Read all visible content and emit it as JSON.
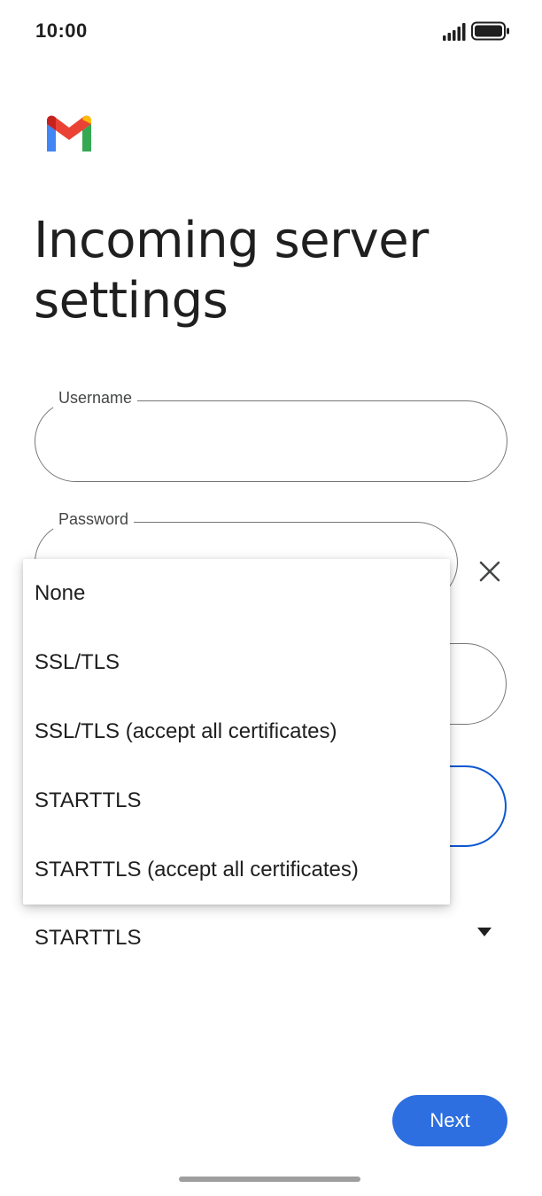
{
  "status_bar": {
    "time": "10:00"
  },
  "page": {
    "title": "Incoming server settings"
  },
  "form": {
    "username": {
      "label": "Username",
      "value": ""
    },
    "password": {
      "label": "Password",
      "value": ""
    },
    "security_type": {
      "selected": "STARTTLS"
    }
  },
  "dropdown": {
    "options": [
      "None",
      "SSL/TLS",
      "SSL/TLS (accept all certificates)",
      "STARTTLS",
      "STARTTLS (accept all certificates)"
    ]
  },
  "actions": {
    "next_label": "Next"
  },
  "colors": {
    "primary": "#2d6fe0",
    "focus_border": "#0b57d0",
    "outline": "#747775"
  },
  "icons": {
    "logo": "gmail-logo",
    "signal": "signal-icon",
    "battery": "battery-icon",
    "clear": "close-icon",
    "password_toggle": "eye-icon",
    "select_arrow": "dropdown-arrow-icon"
  }
}
